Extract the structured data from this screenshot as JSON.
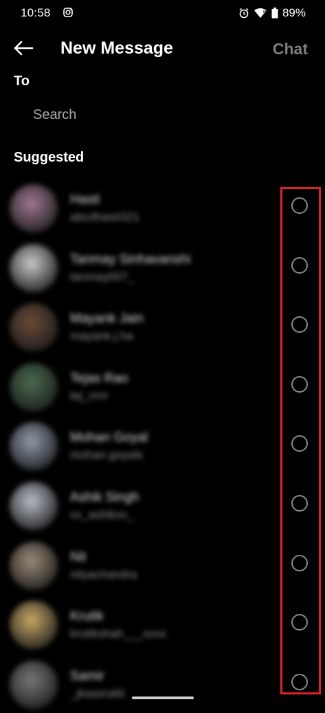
{
  "status_bar": {
    "time": "10:58",
    "battery": "89%",
    "icons": [
      "instagram-icon",
      "alarm-icon",
      "wifi-icon",
      "battery-icon"
    ]
  },
  "header": {
    "title": "New Message",
    "chat_label": "Chat",
    "back_icon": "arrow-left-icon"
  },
  "to_label": "To",
  "search": {
    "placeholder": "Search",
    "value": ""
  },
  "suggested_label": "Suggested",
  "contacts": [
    {
      "name": "Hasti",
      "sub": "abcdhasti321",
      "avatar_color": "#a07890"
    },
    {
      "name": "Tanmay Sinhavanshi",
      "sub": "tanmay007_",
      "avatar_color": "#c9c9c9"
    },
    {
      "name": "Mayank Jain",
      "sub": "mayank.j.ha",
      "avatar_color": "#6b4a38"
    },
    {
      "name": "Tejas Rao",
      "sub": "tej_rrrrr",
      "avatar_color": "#4a6b4f"
    },
    {
      "name": "Mohan Goyal",
      "sub": "mohan.goyals",
      "avatar_color": "#8f9aac"
    },
    {
      "name": "Ashik Singh",
      "sub": "xx_ashikxx_",
      "avatar_color": "#b7bdc8"
    },
    {
      "name": "Nit",
      "sub": "nityachandra",
      "avatar_color": "#9b8a78"
    },
    {
      "name": "Krutik",
      "sub": "krutikshah___xxxx",
      "avatar_color": "#c8a766"
    },
    {
      "name": "Samir",
      "sub": "_jkaseraliii",
      "avatar_color": "#777777"
    }
  ],
  "colors": {
    "background": "#000000",
    "highlight": "#e0202a",
    "muted": "#7f7f7f"
  }
}
